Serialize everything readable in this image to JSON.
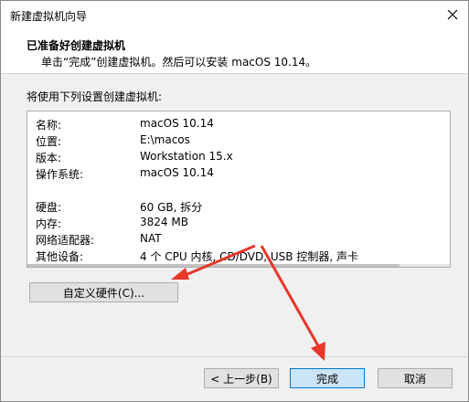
{
  "window": {
    "title": "新建虚拟机向导"
  },
  "header": {
    "title": "已准备好创建虚拟机",
    "subtitle": "单击“完成”创建虚拟机。然后可以安装 macOS 10.14。"
  },
  "intro": "将使用下列设置创建虚拟机:",
  "summary": {
    "name_label": "名称:",
    "name_value": "macOS 10.14",
    "location_label": "位置:",
    "location_value": "E:\\macos",
    "version_label": "版本:",
    "version_value": "Workstation 15.x",
    "os_label": "操作系统:",
    "os_value": "macOS 10.14",
    "disk_label": "硬盘:",
    "disk_value": "60 GB, 拆分",
    "memory_label": "内存:",
    "memory_value": "3824 MB",
    "network_label": "网络适配器:",
    "network_value": "NAT",
    "other_label": "其他设备:",
    "other_value": "4 个 CPU 内核, CD/DVD, USB 控制器, 声卡"
  },
  "buttons": {
    "customize": "自定义硬件(C)...",
    "back": "< 上一步(B)",
    "finish": "完成",
    "cancel": "取消"
  },
  "annotations": {
    "arrow_color": "#e8372b"
  }
}
